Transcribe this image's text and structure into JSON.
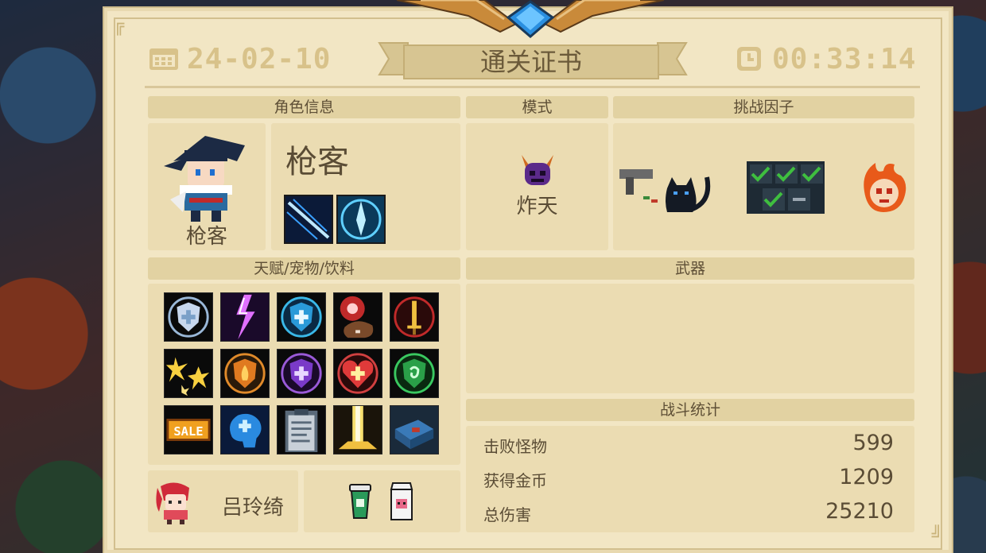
{
  "header": {
    "date": "24-02-10",
    "time": "00:33:14",
    "title": "通关证书"
  },
  "sections": {
    "character_info": "角色信息",
    "mode": "模式",
    "challenge_factors": "挑战因子",
    "talents": "天赋/宠物/饮料",
    "weapons": "武器",
    "battle_stats": "战斗统计"
  },
  "character": {
    "name_large": "枪客",
    "name_under_portrait": "枪客",
    "skills": [
      "slash-skill-icon",
      "spear-burst-skill-icon"
    ]
  },
  "mode": {
    "label": "炸天",
    "icon": "demon-horns-icon"
  },
  "challenge_factors": [
    "gun-and-cat-icon",
    "checklist-icon",
    "flaming-skull-icon"
  ],
  "talents": [
    "shield-plus-icon",
    "lightning-icon",
    "blue-shield-icon",
    "red-orb-icon",
    "sword-ring-icon",
    "sparks-icon",
    "fire-shield-icon",
    "purple-shield-icon",
    "heart-plus-icon",
    "green-shield-icon",
    "sale-icon",
    "brain-icon",
    "clipboard-icon",
    "light-beam-icon",
    "toolbox-icon"
  ],
  "pet": {
    "name": "吕玲绮",
    "icon": "red-hair-girl-icon"
  },
  "drinks": [
    "green-cup-icon",
    "milk-carton-icon"
  ],
  "stats": [
    {
      "label": "击败怪物",
      "value": "599"
    },
    {
      "label": "获得金币",
      "value": "1209"
    },
    {
      "label": "总伤害",
      "value": "25210"
    }
  ],
  "colors": {
    "paper": "#f2e6c4",
    "header_bar": "#e2d2a2",
    "panel": "#ebdcb2",
    "text": "#5a4c35",
    "accent_blue": "#2a8fe0",
    "check_green": "#3fbf3f"
  }
}
